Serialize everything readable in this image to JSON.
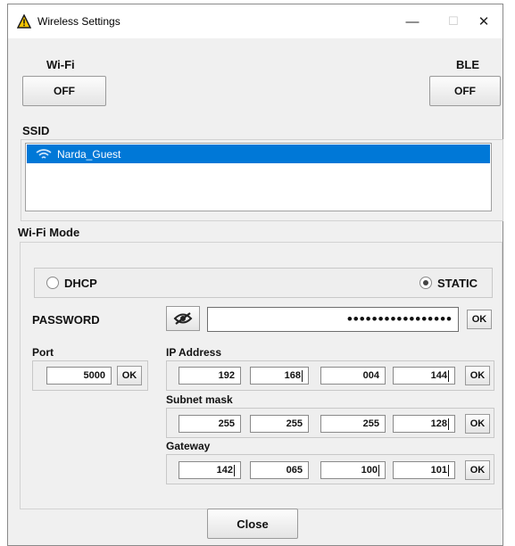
{
  "window": {
    "title": "Wireless Settings",
    "minimize": "—",
    "maximize": "☐",
    "close": "✕"
  },
  "wifi": {
    "label": "Wi-Fi",
    "button": "OFF"
  },
  "ble": {
    "label": "BLE",
    "button": "OFF"
  },
  "ssid": {
    "label": "SSID",
    "items": [
      "Narda_Guest"
    ]
  },
  "mode": {
    "label": "Wi-Fi Mode",
    "dhcp": "DHCP",
    "static": "STATIC",
    "selected": "STATIC"
  },
  "password": {
    "label": "PASSWORD",
    "value": "•••••••••••••••••",
    "ok": "OK"
  },
  "port": {
    "label": "Port",
    "value": "5000",
    "ok": "OK"
  },
  "ip": {
    "label": "IP Address",
    "octets": [
      "192",
      "168",
      "004",
      "144"
    ],
    "ok": "OK"
  },
  "subnet": {
    "label": "Subnet mask",
    "octets": [
      "255",
      "255",
      "255",
      "128"
    ],
    "ok": "OK"
  },
  "gateway": {
    "label": "Gateway",
    "octets": [
      "142",
      "065",
      "100",
      "101"
    ],
    "ok": "OK"
  },
  "close_button": "Close"
}
